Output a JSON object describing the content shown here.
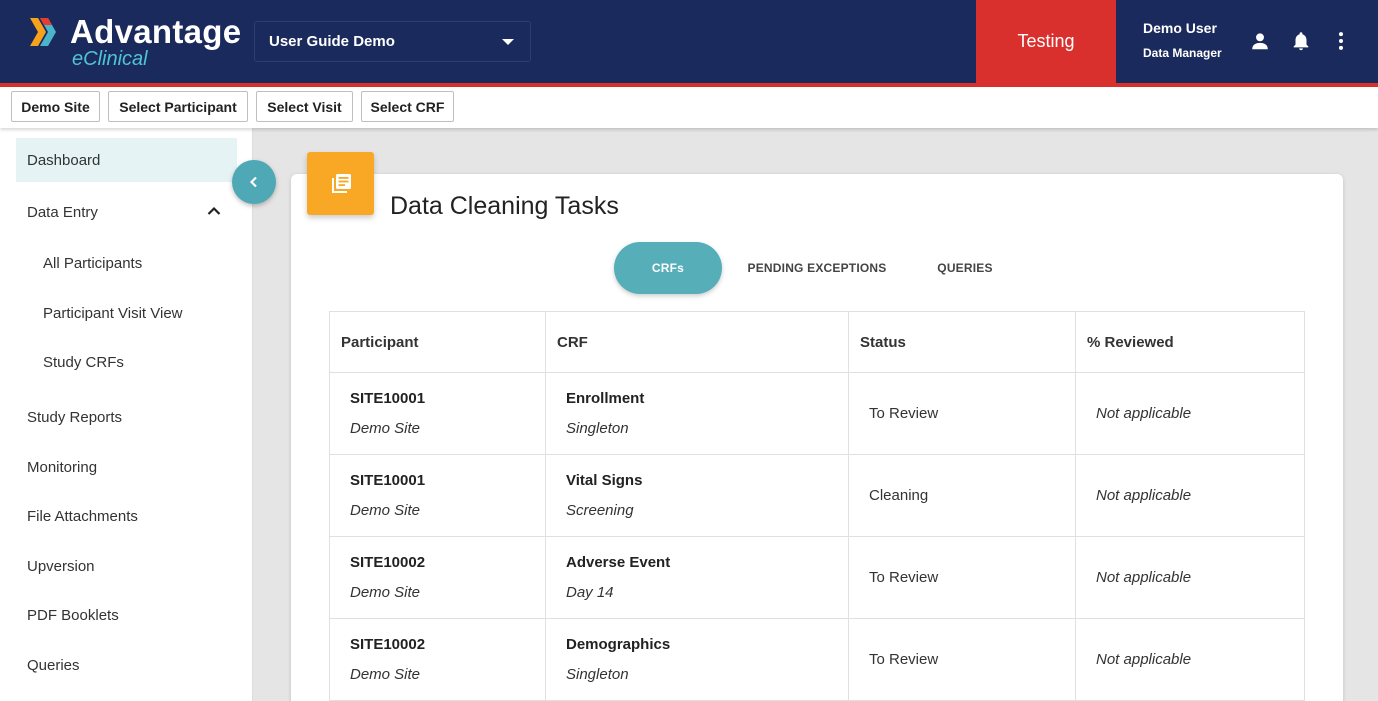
{
  "header": {
    "logo_main": "Advantage",
    "logo_sub": "eClinical",
    "study_selected": "User Guide Demo",
    "environment": "Testing",
    "user_name": "Demo User",
    "user_role": "Data Manager",
    "icons": [
      "account-icon",
      "bell-icon",
      "more-vert-icon"
    ],
    "colors": {
      "navy": "#1b2a5c",
      "red": "#d9302e",
      "teal": "#56aeb8",
      "orange": "#f9a825"
    }
  },
  "context_bar": {
    "site": "Demo Site",
    "participant": "Select Participant",
    "visit": "Select Visit",
    "crf": "Select CRF"
  },
  "sidebar": {
    "items": [
      {
        "label": "Dashboard"
      },
      {
        "label": "Data Entry"
      },
      {
        "label": "All Participants"
      },
      {
        "label": "Participant Visit View"
      },
      {
        "label": "Study CRFs"
      },
      {
        "label": "Study Reports"
      },
      {
        "label": "Monitoring"
      },
      {
        "label": "File Attachments"
      },
      {
        "label": "Upversion"
      },
      {
        "label": "PDF Booklets"
      },
      {
        "label": "Queries"
      }
    ]
  },
  "main": {
    "title": "Data Cleaning Tasks",
    "tabs": [
      {
        "label": "CRFs"
      },
      {
        "label": "PENDING EXCEPTIONS"
      },
      {
        "label": "QUERIES"
      }
    ],
    "table": {
      "columns": [
        "Participant",
        "CRF",
        "Status",
        "% Reviewed"
      ],
      "rows": [
        {
          "participant": "SITE10001",
          "site": "Demo Site",
          "crf": "Enrollment",
          "visit": "Singleton",
          "status": "To Review",
          "reviewed": "Not applicable"
        },
        {
          "participant": "SITE10001",
          "site": "Demo Site",
          "crf": "Vital Signs",
          "visit": "Screening",
          "status": "Cleaning",
          "reviewed": "Not applicable"
        },
        {
          "participant": "SITE10002",
          "site": "Demo Site",
          "crf": "Adverse Event",
          "visit": "Day 14",
          "status": "To Review",
          "reviewed": "Not applicable"
        },
        {
          "participant": "SITE10002",
          "site": "Demo Site",
          "crf": "Demographics",
          "visit": "Singleton",
          "status": "To Review",
          "reviewed": "Not applicable"
        }
      ]
    }
  }
}
